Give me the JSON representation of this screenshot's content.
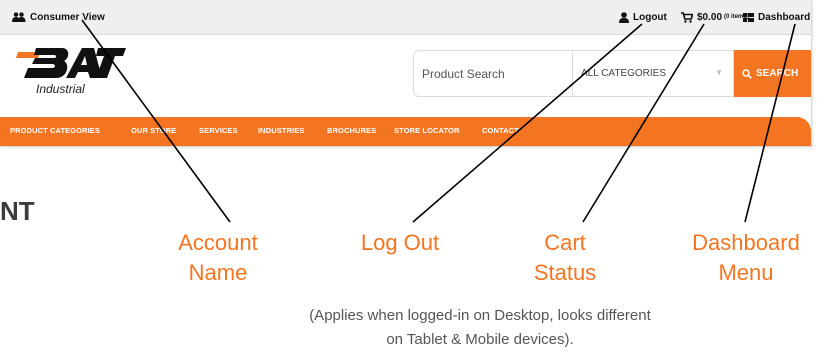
{
  "topbar": {
    "account_name": "Consumer View",
    "logout_label": "Logout",
    "cart_amount": "$0.00",
    "cart_items": "(0 items)",
    "dashboard_label": "Dashboard"
  },
  "logo": {
    "mark": "BAT",
    "subtitle": "Industrial"
  },
  "search": {
    "placeholder": "Product Search",
    "category_value": "ALL CATEGORIES",
    "button_label": "SEARCH"
  },
  "nav": {
    "items": [
      {
        "label": "PRODUCT CATEGORIES"
      },
      {
        "label": "OUR STORE"
      },
      {
        "label": "SERVICES"
      },
      {
        "label": "INDUSTRIES"
      },
      {
        "label": "BROCHURES"
      },
      {
        "label": "STORE LOCATOR"
      },
      {
        "label": "CONTACT"
      }
    ]
  },
  "heading_fragment": "NT",
  "annotations": {
    "account": [
      "Account",
      "Name"
    ],
    "logout": [
      "Log Out"
    ],
    "cart": [
      "Cart",
      "Status"
    ],
    "dashboard": [
      "Dashboard",
      "Menu"
    ]
  },
  "note": {
    "line1": "(Applies when logged-in on Desktop, looks different",
    "line2": "on Tablet & Mobile devices)."
  },
  "colors": {
    "brand_orange": "#f47521",
    "annotation_orange": "#f47521",
    "topbar_bg": "#efefef"
  }
}
